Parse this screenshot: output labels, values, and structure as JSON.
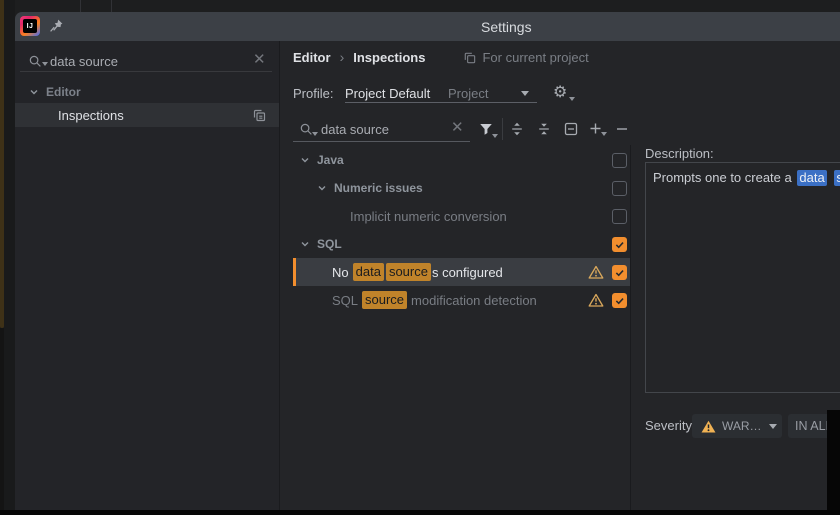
{
  "window": {
    "title": "Settings"
  },
  "icons": {
    "gear": "⚙",
    "clear": "✕",
    "breadcrumb_sep": "›"
  },
  "sidebar": {
    "search": {
      "value": "data source"
    },
    "group_editor": "Editor",
    "item_inspections": "Inspections"
  },
  "main": {
    "breadcrumb": {
      "part1": "Editor",
      "part2": "Inspections",
      "scope": "For current project"
    },
    "profile": {
      "label": "Profile:",
      "value": "Project Default",
      "suffix": "Project"
    },
    "search": {
      "value": "data source"
    },
    "tree": {
      "java": "Java",
      "numeric_issues": "Numeric issues",
      "implicit": "Implicit numeric conversion",
      "sql": "SQL",
      "no_data": {
        "prefix": "No",
        "hl1": "data",
        "hl2": "source",
        "suffix": "s configured"
      },
      "sql_source": {
        "prefix": "SQL",
        "hl1": "source",
        "suffix": "modification detection"
      },
      "checkbox_states": {
        "java": false,
        "numeric_issues": false,
        "implicit": false,
        "sql": true,
        "no_data": true,
        "sql_source": true
      }
    },
    "description": {
      "label": "Description:",
      "prefix": "Prompts one to create a",
      "hl1": "data",
      "hl2": "source"
    },
    "severity": {
      "label": "Severity:",
      "value": "WAR…",
      "scope": "IN ALL"
    }
  },
  "colors": {
    "accent_orange": "#F28E2E",
    "match_highlight": "#C0832A",
    "selection_blue": "#3B70C5",
    "warning_amber": "#F0B254",
    "titlebar": "#3C4046",
    "panel": "#232428"
  }
}
